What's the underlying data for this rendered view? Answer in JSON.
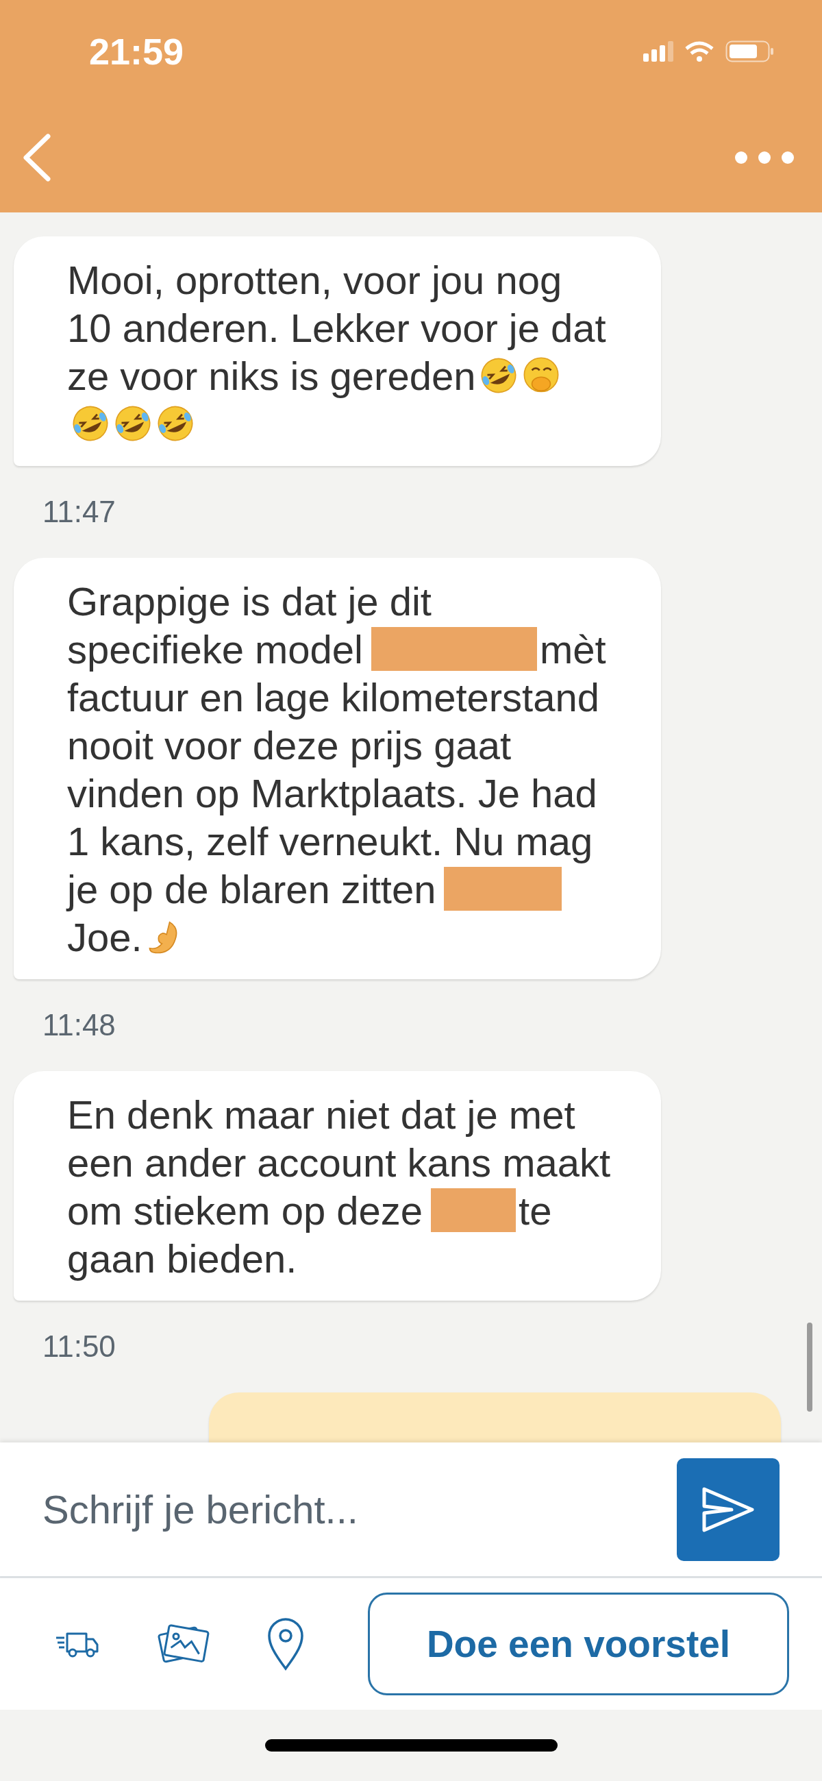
{
  "status_bar": {
    "time": "21:59"
  },
  "messages": [
    {
      "kind": "received",
      "time": "11:47",
      "lines": [
        [
          {
            "kind": "text",
            "text": "Mooi, oprotten, voor jou nog"
          }
        ],
        [
          {
            "kind": "text",
            "text": "10 anderen. Lekker voor je dat"
          }
        ],
        [
          {
            "kind": "text",
            "text": "ze voor niks is gereden"
          },
          {
            "kind": "laughing-emoji"
          },
          {
            "kind": "covered-mouth-emoji"
          }
        ],
        [
          {
            "kind": "laughing-emoji"
          },
          {
            "kind": "laughing-emoji"
          },
          {
            "kind": "laughing-emoji"
          }
        ]
      ]
    },
    {
      "kind": "received",
      "time": "11:48",
      "lines": [
        [
          {
            "kind": "text",
            "text": "Grappige is dat je dit"
          }
        ],
        [
          {
            "kind": "text",
            "text": "specifieke model"
          },
          {
            "kind": "redacted"
          },
          {
            "kind": "text",
            "text": "mèt"
          }
        ],
        [
          {
            "kind": "text",
            "text": "factuur en lage kilometerstand"
          }
        ],
        [
          {
            "kind": "text",
            "text": "nooit voor deze prijs gaat"
          }
        ],
        [
          {
            "kind": "text",
            "text": "vinden op Marktplaats. Je had"
          }
        ],
        [
          {
            "kind": "text",
            "text": "1 kans, zelf verneukt. Nu mag"
          }
        ],
        [
          {
            "kind": "text",
            "text": "je op de blaren zitten"
          },
          {
            "kind": "redacted"
          }
        ],
        [
          {
            "kind": "text",
            "text": "Joe."
          },
          {
            "kind": "hand-emoji"
          }
        ]
      ]
    },
    {
      "kind": "received",
      "time": "11:50",
      "lines": [
        [
          {
            "kind": "text",
            "text": "En denk maar niet dat je met"
          }
        ],
        [
          {
            "kind": "text",
            "text": "een ander account kans maakt"
          }
        ],
        [
          {
            "kind": "text",
            "text": "om stiekem op deze"
          },
          {
            "kind": "redacted"
          },
          {
            "kind": "text",
            "text": "te"
          }
        ],
        [
          {
            "kind": "text",
            "text": "gaan bieden."
          }
        ]
      ]
    },
    {
      "kind": "sent"
    }
  ],
  "composer": {
    "placeholder": "Schrijf je bericht..."
  },
  "offer_button": {
    "label": "Doe een voorstel"
  }
}
